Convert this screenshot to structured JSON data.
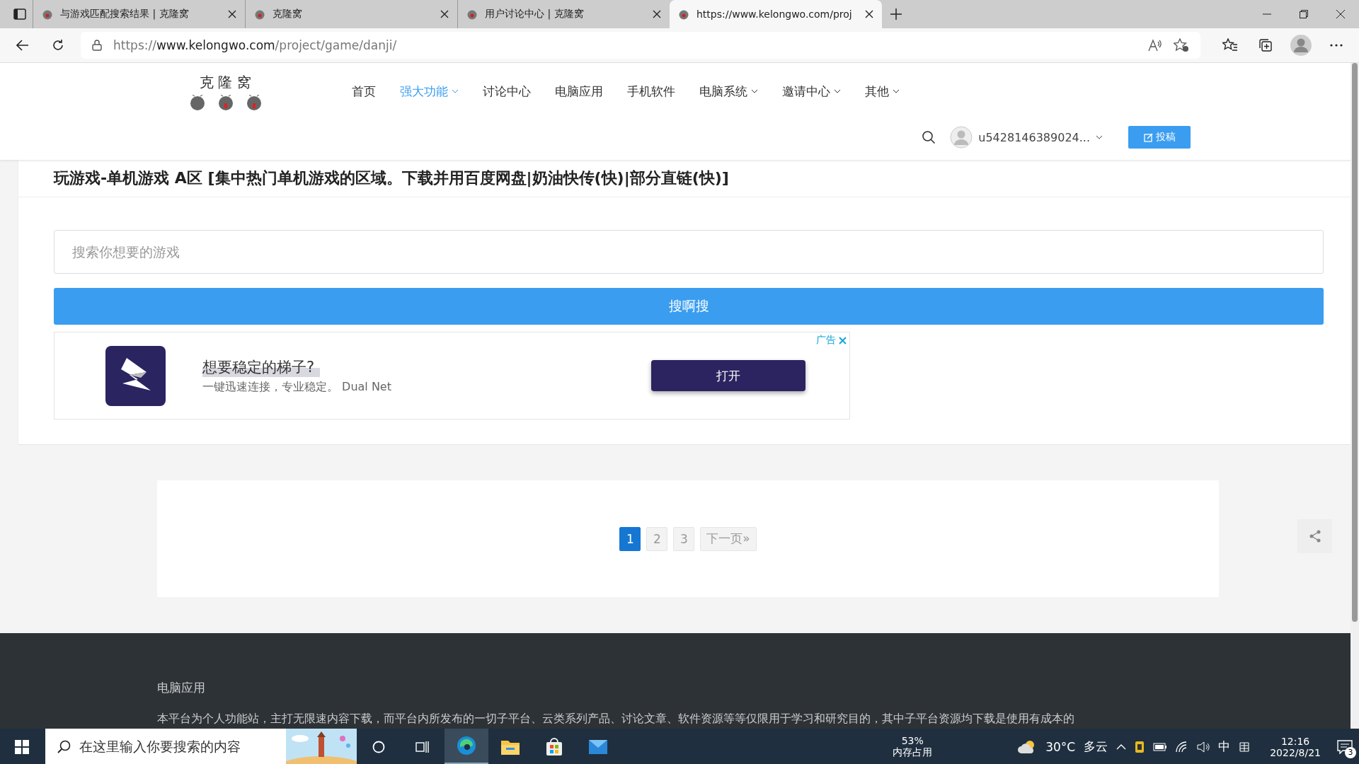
{
  "browser": {
    "tabs": [
      {
        "title": "与游戏匹配搜索结果 | 克隆窝",
        "selected": false
      },
      {
        "title": "克隆窝",
        "selected": false
      },
      {
        "title": "用户讨论中心 | 克隆窝",
        "selected": false
      },
      {
        "title": "https://www.kelongwo.com/proj",
        "selected": true
      }
    ],
    "url_scheme": "https://",
    "url_host": "www.kelongwo.com",
    "url_path": "/project/game/danji/"
  },
  "site": {
    "logo_text": "克 隆 窝",
    "nav": [
      {
        "label": "首页",
        "selected": false,
        "dropdown": false
      },
      {
        "label": "强大功能",
        "selected": true,
        "dropdown": true
      },
      {
        "label": "讨论中心",
        "selected": false,
        "dropdown": false
      },
      {
        "label": "电脑应用",
        "selected": false,
        "dropdown": false
      },
      {
        "label": "手机软件",
        "selected": false,
        "dropdown": false
      },
      {
        "label": "电脑系统",
        "selected": false,
        "dropdown": true
      },
      {
        "label": "邀请中心",
        "selected": false,
        "dropdown": true
      },
      {
        "label": "其他",
        "selected": false,
        "dropdown": true
      }
    ],
    "user_name": "u5428146389024...",
    "post_button": "投稿"
  },
  "title": "玩游戏-单机游戏 A区 [集中热门单机游戏的区域。下载并用百度网盘|奶油快传(快)|部分直链(快)]",
  "search": {
    "placeholder": "搜索你想要的游戏",
    "button": "搜啊搜"
  },
  "ad": {
    "label": "广告",
    "headline": "想要稳定的梯子?",
    "subline": "一键迅速连接，专业稳定。",
    "brand": "Dual Net",
    "button": "打开"
  },
  "pagination": [
    {
      "label": "1",
      "selected": true
    },
    {
      "label": "2",
      "selected": false
    },
    {
      "label": "3",
      "selected": false
    },
    {
      "label": "下一页»",
      "selected": false
    }
  ],
  "footer": {
    "heading": "电脑应用",
    "text": "本平台为个人功能站，主打无限速内容下载，而平台内所发布的一切子平台、云类系列产品、讨论文章、软件资源等等仅限用于学习和研究目的，其中子平台资源均下载是使用有成本的"
  },
  "taskbar": {
    "search_placeholder": "在这里输入你要搜索的内容",
    "memory_percent": "53%",
    "memory_label": "内存占用",
    "temperature": "30°C",
    "weather": "多云",
    "ime": "中",
    "time": "12:16",
    "date": "2022/8/21",
    "notifications": "3"
  }
}
